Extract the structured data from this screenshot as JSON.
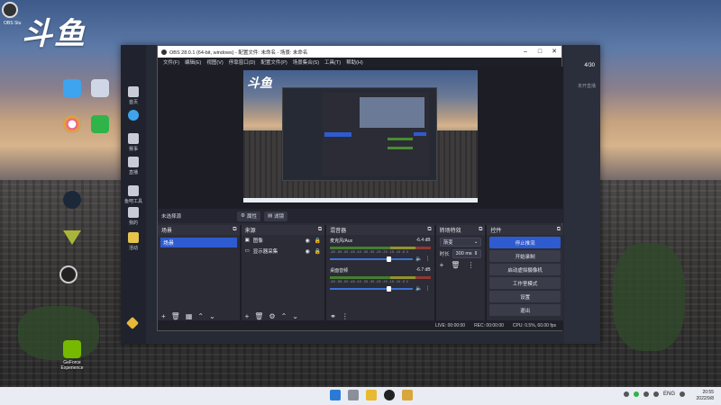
{
  "desktop": {
    "brand": "斗鱼",
    "top_left_label": "OBS Stu",
    "icons": [
      {
        "name": "computer-icon",
        "label": "",
        "color": "#3ea4ef"
      },
      {
        "name": "recycle-bin-icon",
        "label": "",
        "color": "#cfd7e6"
      },
      {
        "name": "app-icon-1",
        "label": "",
        "color": "#e85a9a"
      },
      {
        "name": "app-icon-2",
        "label": "",
        "color": "#2fb44a"
      },
      {
        "name": "steam-icon",
        "label": "",
        "color": "#1b2838"
      },
      {
        "name": "app-icon-3",
        "label": "",
        "color": "#a8b53a"
      },
      {
        "name": "obs-icon",
        "label": "",
        "color": "#222"
      },
      {
        "name": "geforce-icon",
        "label": "GeForce Experience",
        "color": "#76b900"
      }
    ]
  },
  "douyu": {
    "side_items": [
      {
        "name": "home-icon",
        "label": "首页"
      },
      {
        "name": "edge-icon",
        "label": ""
      },
      {
        "name": "trophy-icon",
        "label": "赛事"
      },
      {
        "name": "monitor-icon",
        "label": "直播"
      },
      {
        "name": "tools-icon",
        "label": "鱼吧工具"
      },
      {
        "name": "gift-icon",
        "label": "我的"
      },
      {
        "name": "activity-icon",
        "label": "活动"
      }
    ],
    "top_user": "4/30",
    "live_status": "未开直播"
  },
  "obs": {
    "title": "OBS 28.0.1 (64-bit, windows) - 配置文件: 未命名 - 场景: 未命名",
    "menu": [
      "文件(F)",
      "编辑(E)",
      "视图(V)",
      "停靠窗口(D)",
      "配置文件(P)",
      "场景集合(S)",
      "工具(T)",
      "帮助(H)"
    ],
    "toolbar": {
      "no_source": "未选择源",
      "properties": "属性",
      "filters": "滤镜"
    },
    "scenes": {
      "header": "场景",
      "items": [
        "场景"
      ]
    },
    "sources": {
      "header": "来源",
      "items": [
        {
          "name": "image-icon",
          "label": "图像"
        },
        {
          "name": "display-icon",
          "label": "显示器采集"
        }
      ]
    },
    "mixer": {
      "header": "混音器",
      "tracks": [
        {
          "name": "麦克风/Aux",
          "db": "-6.4 dB",
          "level": 0.68
        },
        {
          "name": "桌面音频",
          "db": "-6.7 dB",
          "level": 0.68
        }
      ],
      "ticks": "-60 -55 -50 -45 -40 -35 -30 -25 -20 -15 -10 -5 0"
    },
    "transitions": {
      "header": "转场特效",
      "type": "渐变",
      "duration_label": "时长",
      "duration": "300 ms"
    },
    "controls": {
      "header": "控件",
      "buttons": [
        "停止推流",
        "开始录制",
        "启动虚拟摄像机",
        "工作室模式",
        "设置",
        "退出"
      ]
    },
    "status": {
      "live": "LIVE: 00:00:00",
      "rec": "REC: 00:00:00",
      "cpu": "CPU: 0.5%, 60.00 fps"
    }
  },
  "taskbar": {
    "lang": "ENG",
    "time": "20:55",
    "date": "2022/9/8"
  }
}
